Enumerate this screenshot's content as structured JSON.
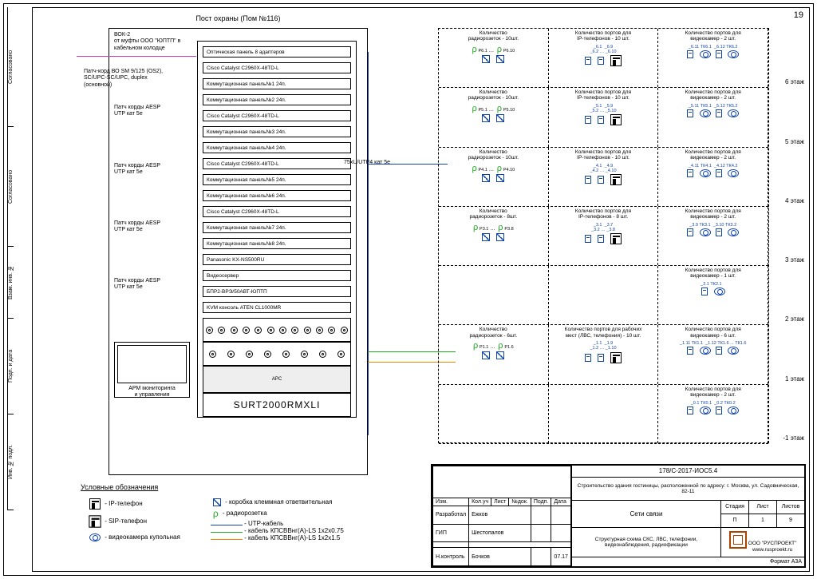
{
  "page_number": "19",
  "side_tabs": [
    "Согласовано",
    "Согласовано",
    "Взам. инв. №",
    "Подп. и дата",
    "Инв. № подл."
  ],
  "rack": {
    "title": "Пост охраны (Пом №116)",
    "top_note": "ВОК-2\nот муфты ООО \"ЮПТП\" в\nкабельном колодце",
    "patch_note_main": "Патч-корд ВО SM 9/125 (OS2),\nSC/UPC-SC/UPC, duplex\n(основной)",
    "patch_group_label": "Патч корды AESP\nUTP кат 5e",
    "monitor_label": "АРМ мониторинга\nи управления",
    "units": [
      "Оптическая панель 8 адаптеров",
      "Cisco Catalyst C2960X-48TD-L",
      "Коммутационная панель№1 24п.",
      "Коммутационная панель№2 24п.",
      "Cisco Catalyst C2960X-48TD-L",
      "Коммутационная панель№3 24п.",
      "Коммутационная панель№4 24п.",
      "Cisco Catalyst C2960X-48TD-L",
      "Коммутационная панель№5 24п.",
      "Коммутационная панель№6 24п.",
      "Cisco Catalyst C2960X-48TD-L",
      "Коммутационная панель№7 24п.",
      "Коммутационная панель№8 24п.",
      "Panasonic KX-NS500RU",
      "Видеосервер",
      "БПР2-ВРЭ/50АВТ-ЮПТП",
      "KVM консоль ATEN CL1000MR"
    ],
    "ups_label": "SURT2000RMXLI"
  },
  "mid_cable_label": "75xU/UTP4 кат 5e",
  "floors": [
    {
      "label": "6 этаж",
      "cells": [
        {
          "hdr": "Количество\nрадиорозеток - 10шт.",
          "p_from": "Р6.1",
          "p_to": "Р6.10"
        },
        {
          "hdr": "Количество портов для\nIP-телефонов - 10 шт.",
          "v1": "_6.1",
          "v2": "_6.9",
          "v3": "_6.2",
          "v4": "_6.10",
          "phone": true
        },
        {
          "hdr": "Количество портов для\nвидеокамер - 2 шт.",
          "tk1": "ТК6.1",
          "tk2": "ТК6.2",
          "c1": "_6.11",
          "c2": "_6.12",
          "cam": true
        }
      ]
    },
    {
      "label": "5 этаж",
      "cells": [
        {
          "hdr": "Количество\nрадиорозеток - 10шт.",
          "p_from": "Р5.1",
          "p_to": "Р5.10"
        },
        {
          "hdr": "Количество портов для\nIP-телефонов - 10 шт.",
          "v1": "_5.1",
          "v2": "_5.9",
          "v3": "_5.2",
          "v4": "_5.10",
          "phone": true
        },
        {
          "hdr": "Количество портов для\nвидеокамер - 2 шт.",
          "tk1": "ТК5.1",
          "tk2": "ТК5.2",
          "c1": "_5.11",
          "c2": "_5.12",
          "cam": true
        }
      ]
    },
    {
      "label": "4 этаж",
      "cells": [
        {
          "hdr": "Количество\nрадиорозеток - 10шт.",
          "p_from": "Р4.1",
          "p_to": "Р4.10"
        },
        {
          "hdr": "Количество портов для\nIP-телефонов - 10 шт.",
          "v1": "_4.1",
          "v2": "_4.9",
          "v3": "_4.2",
          "v4": "_4.10",
          "phone": true
        },
        {
          "hdr": "Количество портов для\nвидеокамер - 2 шт.",
          "tk1": "ТК4.1",
          "tk2": "ТК4.2",
          "c1": "_4.11",
          "c2": "_4.12",
          "cam": true
        }
      ]
    },
    {
      "label": "3 этаж",
      "cells": [
        {
          "hdr": "Количество\nрадиорозеток - 8шт.",
          "p_from": "Р3.1",
          "p_to": "Р3.8"
        },
        {
          "hdr": "Количество портов для\nIP-телефонов - 8 шт.",
          "v1": "_3.1",
          "v2": "_3.7",
          "v3": "_3.2",
          "v4": "_3.8",
          "phone": true
        },
        {
          "hdr": "Количество портов для\nвидеокамер - 2 шт.",
          "tk1": "ТК3.1",
          "tk2": "ТК3.2",
          "c1": "_3.9",
          "c2": "_3.10",
          "cam": true
        }
      ]
    },
    {
      "label": "2 этаж",
      "cells": [
        {
          "blank": true
        },
        {
          "blank": true
        },
        {
          "hdr": "Количество портов для\nвидеокамер - 1 шт.",
          "tk1": "ТК2.1",
          "c1": "_2.1",
          "cam": true,
          "single": true
        }
      ]
    },
    {
      "label": "1 этаж",
      "cells": [
        {
          "hdr": "Количество\nрадиорозеток - 6шт.",
          "p_from": "Р1.1",
          "p_to": "Р1.6"
        },
        {
          "hdr": "Количество портов для рабочих\nмест (ЛВС, телефония) - 10 шт.",
          "v1": "_1.1",
          "v2": "_1.9",
          "v3": "_1.2",
          "v4": "_1.10",
          "phone": true
        },
        {
          "hdr": "Количество портов для\nвидеокамер - 6 шт.",
          "tk1": "ТК1.1",
          "tk2": "ТК1.6",
          "extra": "... ТК1.6",
          "c1": "_1.11",
          "c2": "_1.12",
          "cam": true
        }
      ]
    },
    {
      "label": "-1 этаж",
      "cells": [
        {
          "blank": true
        },
        {
          "blank": true
        },
        {
          "hdr": "Количество портов для\nвидеокамер - 2 шт.",
          "tk1": "ТК0.1",
          "tk2": "ТК0.2",
          "c1": "_0.1",
          "c2": "_0.2",
          "cam": true
        }
      ]
    }
  ],
  "legend": {
    "title": "Условные обозначения",
    "rows": [
      {
        "sym": "phone",
        "text": "- IP-телефон"
      },
      {
        "sym": "sip",
        "text": "- SIP-телефон"
      },
      {
        "sym": "cam",
        "text": "- видеокамера купольная"
      }
    ],
    "rows2": [
      {
        "sym": "box",
        "text": "- коробка клеммная ответвительная"
      },
      {
        "sym": "rj",
        "text": "- радиорозетка"
      },
      {
        "sym": "line",
        "color": "#14a",
        "text": "- UTP-кабель"
      },
      {
        "sym": "line",
        "color": "#2a2",
        "text": "- кабель КПСВВнг(А)-LS 1x2x0.75"
      },
      {
        "sym": "line",
        "color": "#e80",
        "text": "- кабель КПСВВнг(А)-LS 1x2x1.5"
      }
    ]
  },
  "titleblock": {
    "code": "178/С-2017-ИОС5.4",
    "project": "Строительство здания гостиницы, расположенной по адресу: г. Москва, ул. Садовническая, 82-11",
    "section": "Сети связи",
    "sheet_type": "Структурная схема СКС, ЛВС, телефонии,\nвидеонаблюдения, радиофикации",
    "stage": "П",
    "sheet": "1",
    "sheets": "9",
    "company": "ООО \"РУСПРОЕКТ\"\nwww.rusproekt.ru",
    "format": "Формат А3А",
    "hdr_row": [
      "Изм.",
      "Кол.уч",
      "Лист",
      "№док.",
      "Подп.",
      "Дата"
    ],
    "roles": [
      {
        "r": "Разработал",
        "n": "Ежков"
      },
      {
        "r": "ГИП",
        "n": "Шестопалов"
      },
      {
        "r": "Н.контроль",
        "n": "Бочков",
        "d": "07.17"
      }
    ],
    "cols": [
      "Стадия",
      "Лист",
      "Листов"
    ]
  }
}
